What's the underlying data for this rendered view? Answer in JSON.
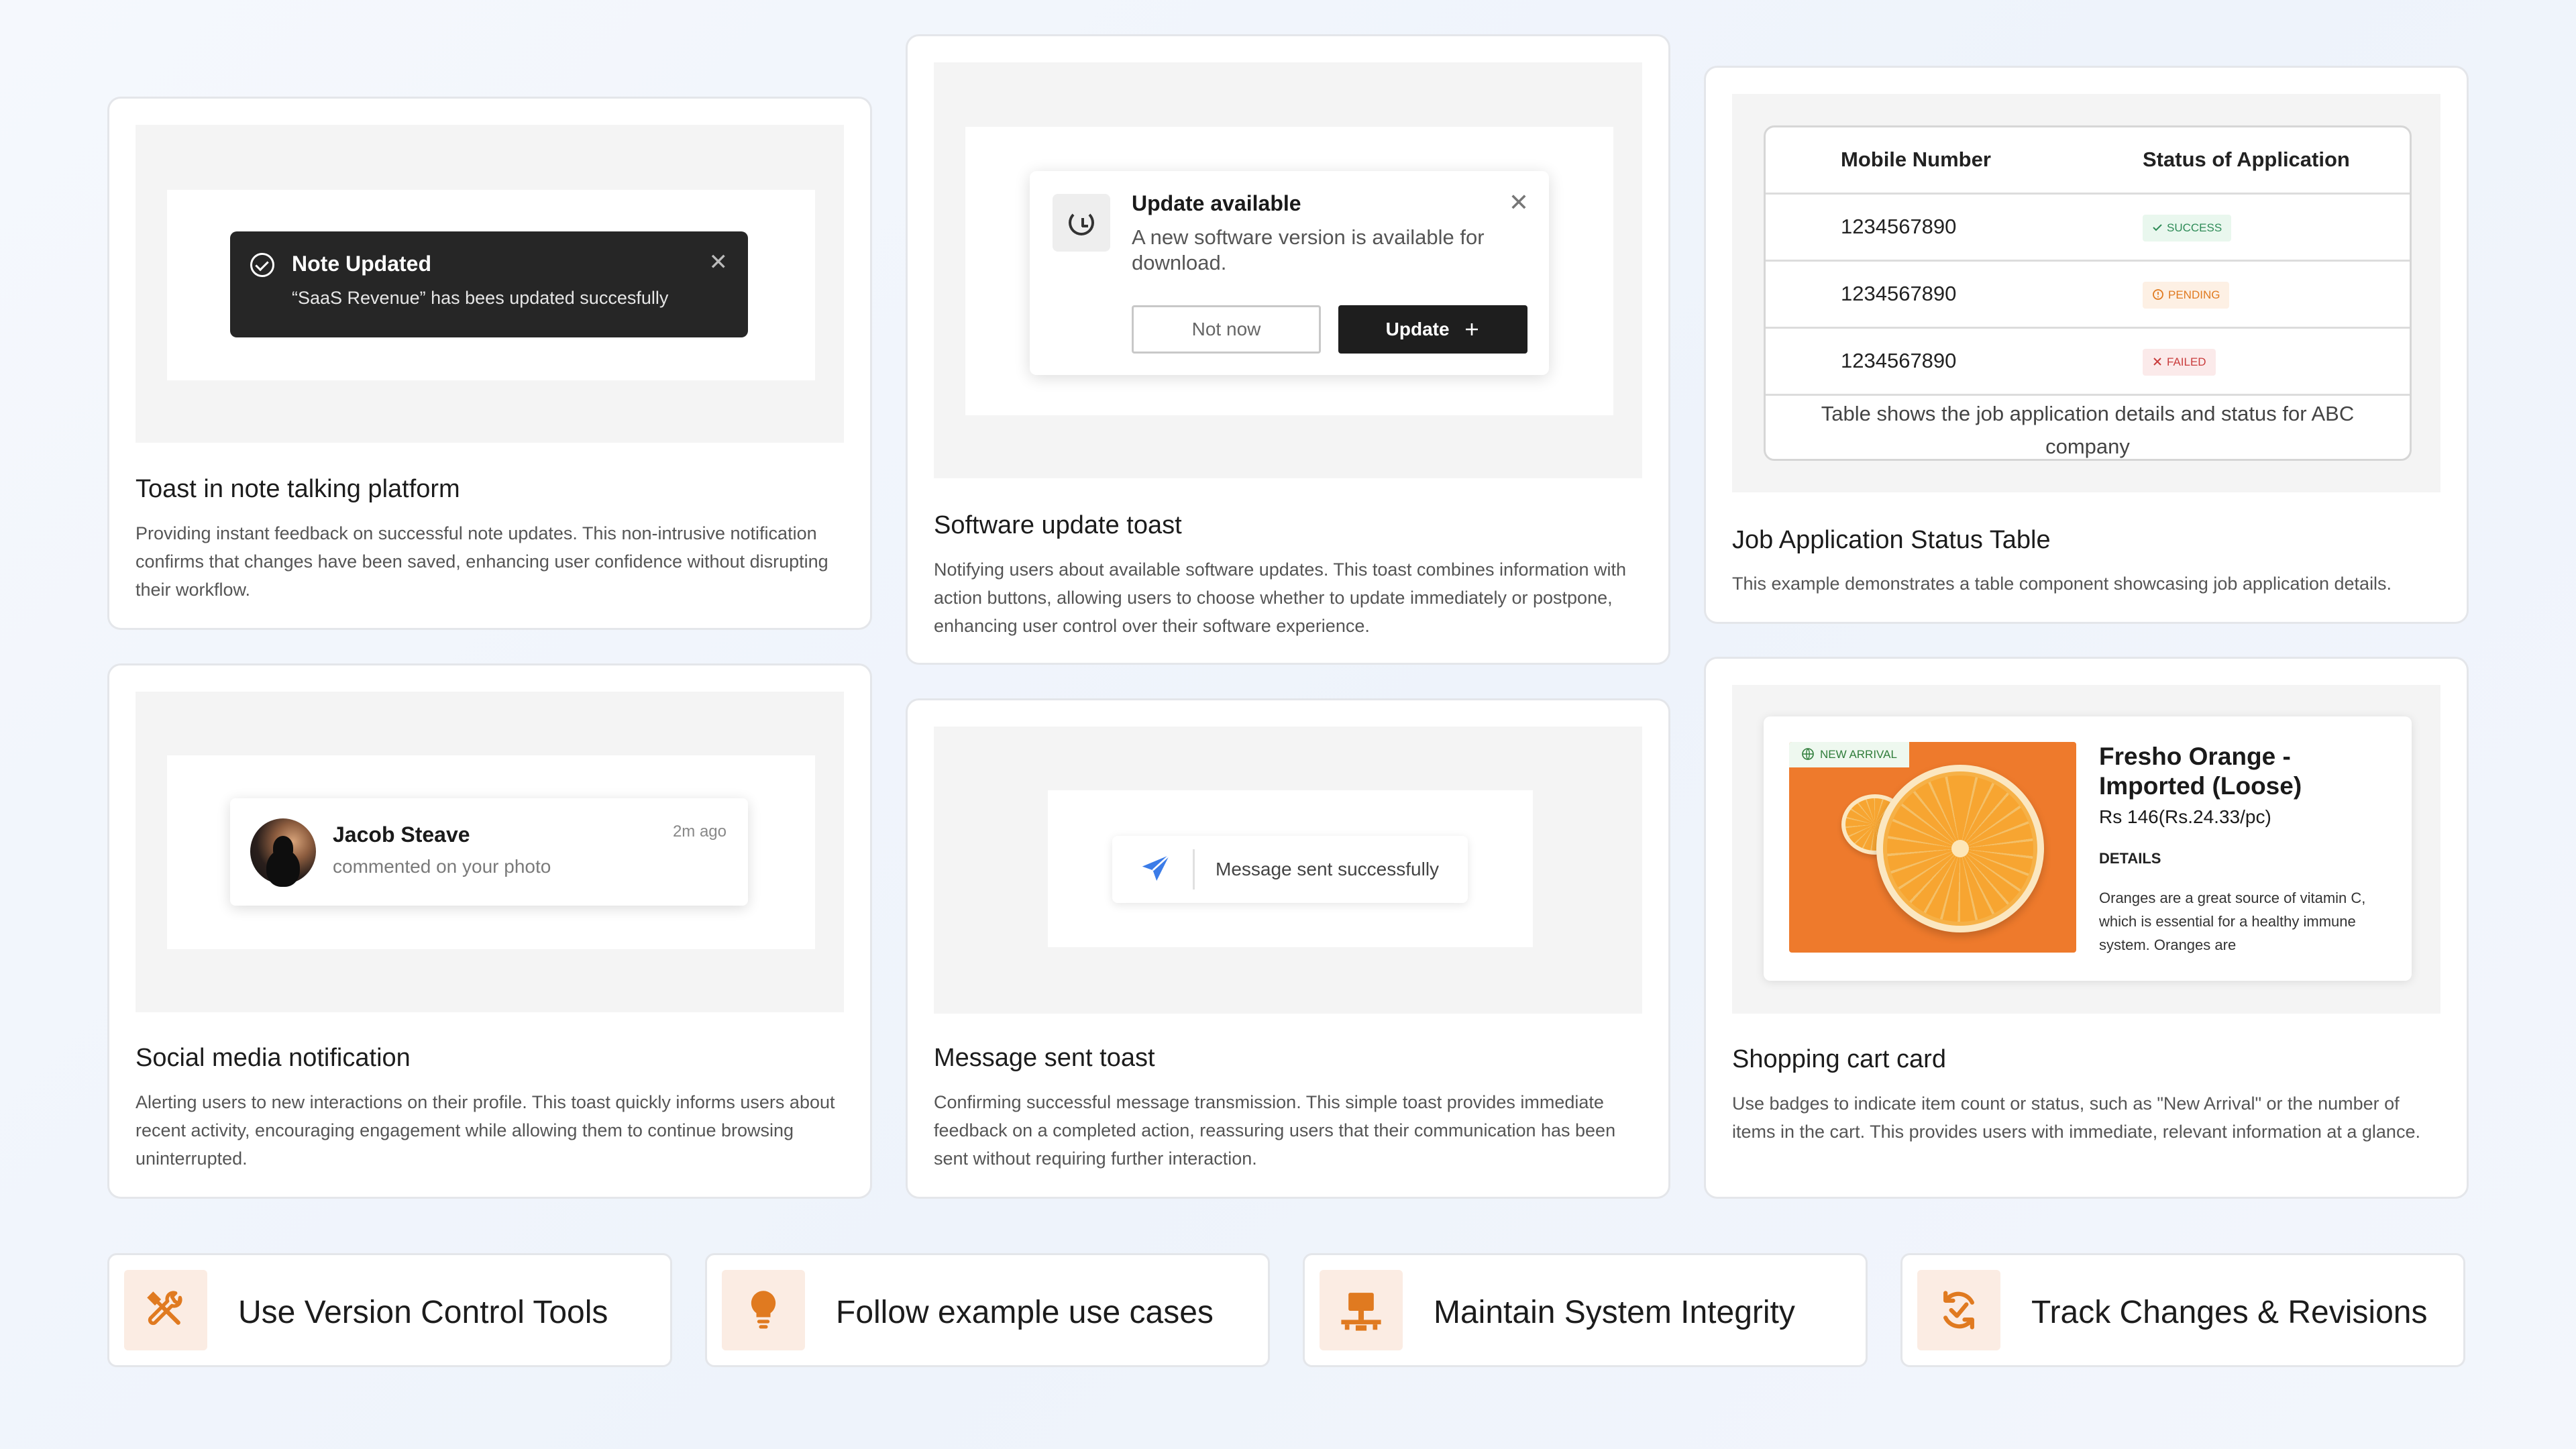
{
  "cards": {
    "note": {
      "toast_title": "Note Updated",
      "toast_body": "“SaaS Revenue” has bees updated succesfully",
      "close_glyph": "✕",
      "title": "Toast in note talking platform",
      "description": "Providing instant feedback on successful note updates. This non-intrusive notification confirms that changes have been saved, enhancing user confidence without disrupting their workflow."
    },
    "software": {
      "toast_title": "Update available",
      "toast_body": "A new software version is available for download.",
      "close_glyph": "✕",
      "secondary_button": "Not now",
      "primary_button": "Update",
      "primary_button_icon": "plus-icon",
      "title": "Software update toast",
      "description": "Notifying users about available software updates. This toast combines information with action buttons, allowing users to choose whether to update immediately or postpone, enhancing user control over their software experience."
    },
    "jobs": {
      "columns": [
        "Mobile Number",
        "Status of Application"
      ],
      "rows": [
        {
          "number": "1234567890",
          "status": "SUCCESS",
          "status_icon": "check-icon",
          "color": "#2e8b57"
        },
        {
          "number": "1234567890",
          "status": "PENDING",
          "status_icon": "clock-icon",
          "color": "#e07a20"
        },
        {
          "number": "1234567890",
          "status": "FAILED",
          "status_icon": "x-icon",
          "color": "#c93c3c"
        }
      ],
      "caption": "Table shows the job application details and status for ABC company",
      "title": "Job Application Status Table",
      "description": "This example demonstrates a table component showcasing job application details."
    },
    "social": {
      "name": "Jacob Steave",
      "action": "commented on your photo",
      "time": "2m ago",
      "title": "Social media notification",
      "description": "Alerting users to new interactions on their profile. This toast quickly informs users about recent activity, encouraging engagement while allowing them to continue browsing uninterrupted."
    },
    "message": {
      "toast_text": "Message sent successfully",
      "icon": "send-icon",
      "title": "Message sent toast",
      "description": "Confirming successful message transmission. This simple toast provides immediate feedback on a completed action, reassuring users that their communication has been sent without requiring further interaction."
    },
    "shopping": {
      "badge": "NEW ARRIVAL",
      "product_name": "Fresho Orange - Imported (Loose)",
      "price": "Rs 146(Rs.24.33/pc)",
      "details_label": "DETAILS",
      "details_text": "Oranges are a great source of vitamin C, which is essential for a healthy immune system. Oranges are",
      "title": "Shopping cart card",
      "description": "Use badges to indicate item count or status, such as \"New Arrival\" or the number of items in the cart. This provides users with immediate, relevant information at a glance."
    }
  },
  "tiles": [
    {
      "label": "Use Version Control Tools",
      "icon": "tools-icon"
    },
    {
      "label": "Follow example use cases",
      "icon": "lightbulb-icon"
    },
    {
      "label": "Maintain System Integrity",
      "icon": "network-icon"
    },
    {
      "label": "Track Changes & Revisions",
      "icon": "refresh-check-icon"
    }
  ],
  "colors": {
    "accent": "#e07a20",
    "dark": "#262626",
    "send_blue": "#3b7ce8",
    "orange_bg": "#ee7a2c"
  }
}
